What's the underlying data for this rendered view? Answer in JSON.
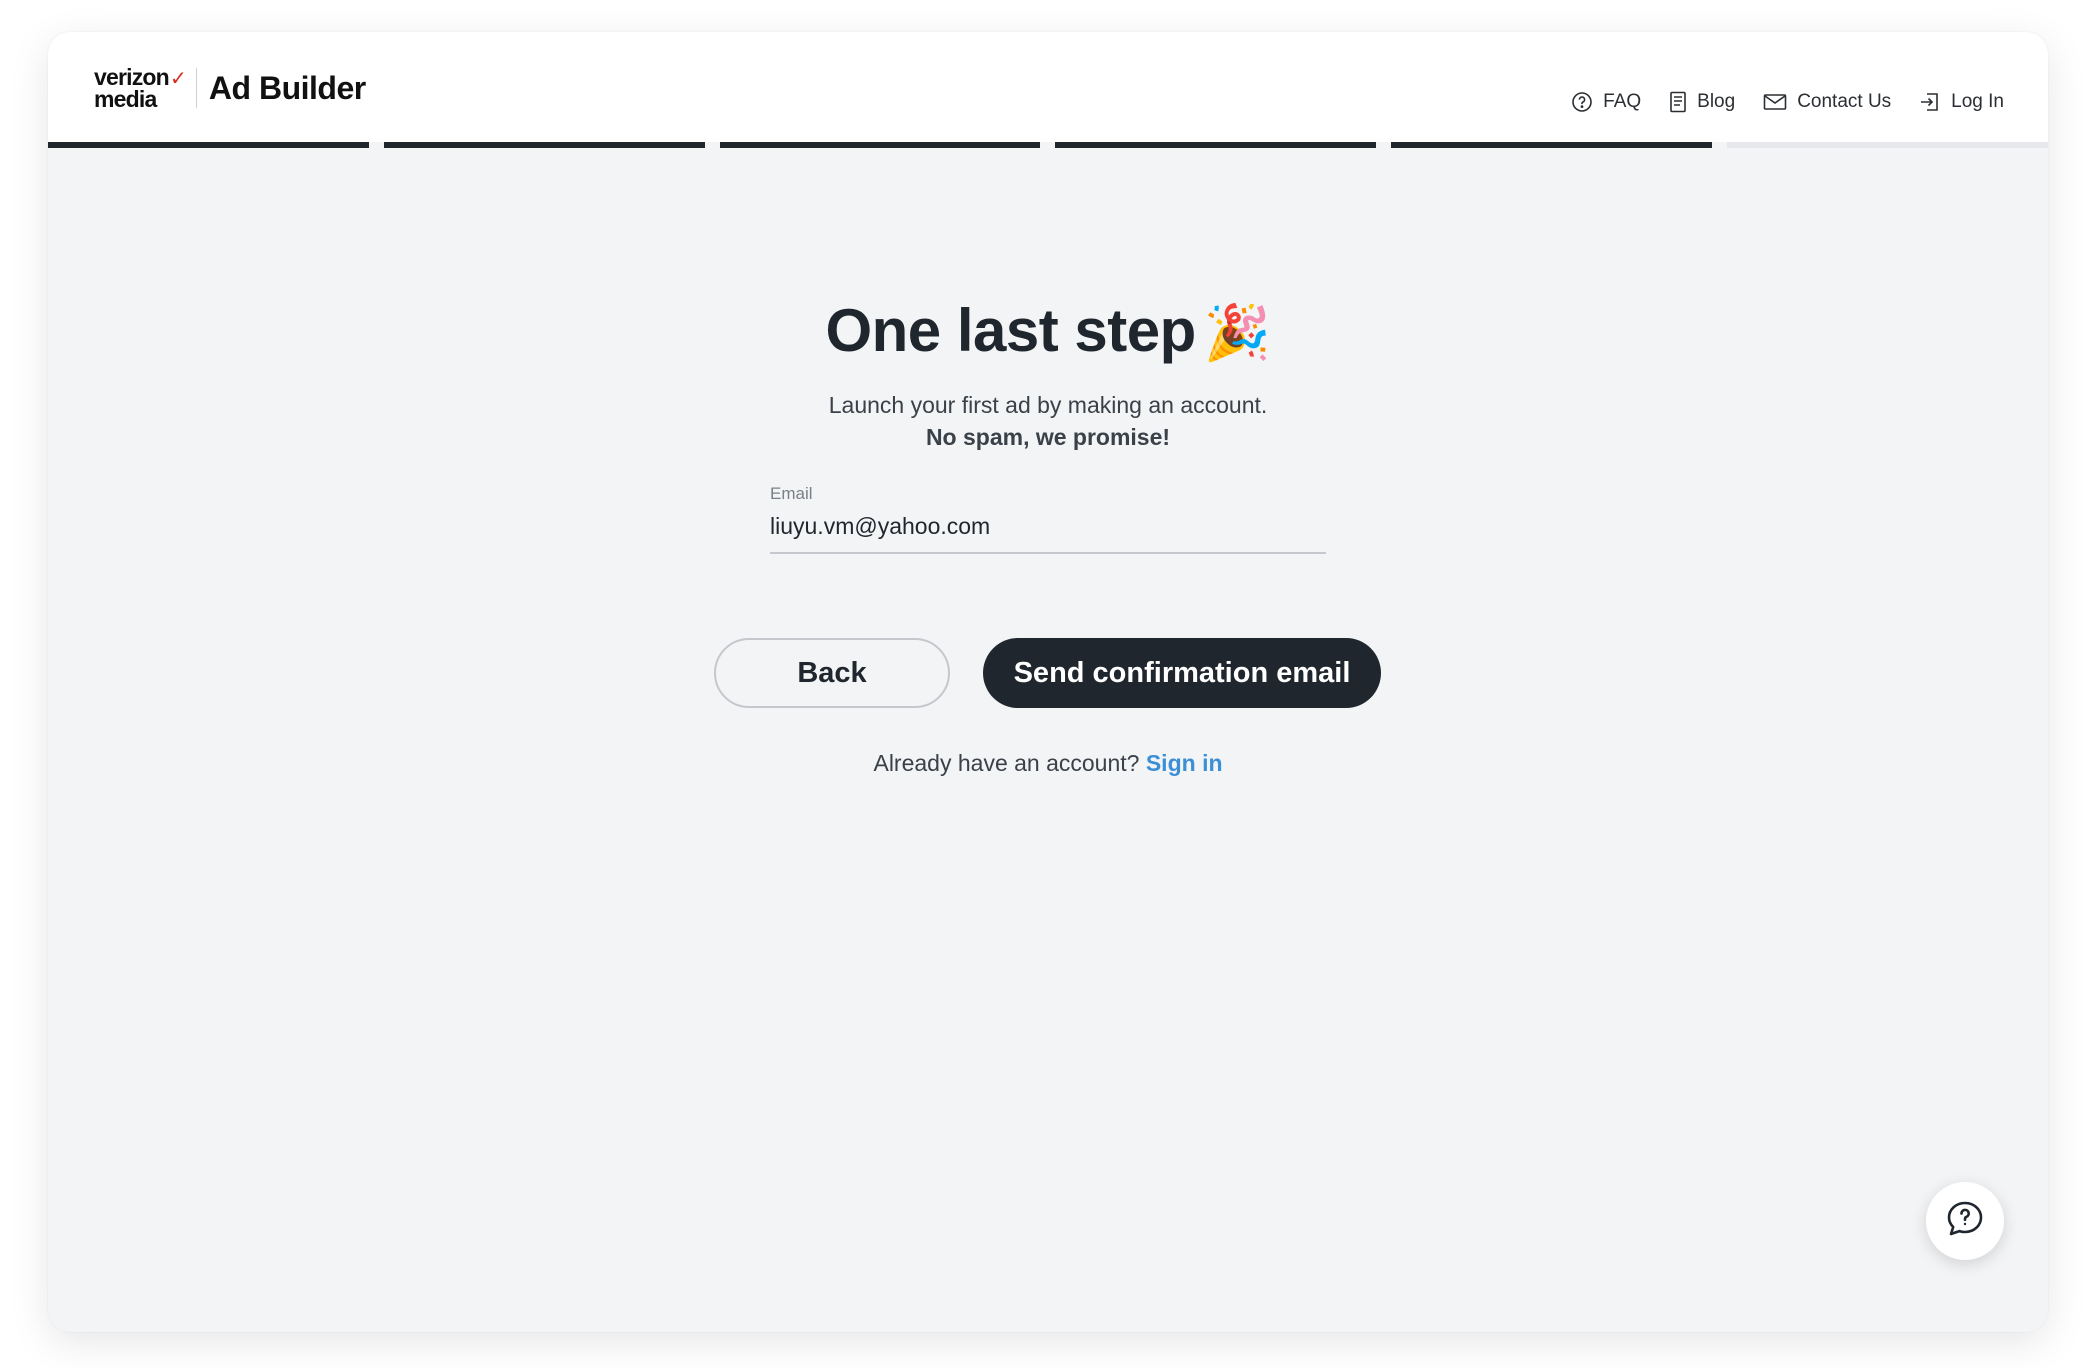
{
  "header": {
    "brand_line1": "verizon",
    "brand_check": "✓",
    "brand_line2": "media",
    "product": "Ad Builder",
    "nav": [
      {
        "label": "FAQ",
        "icon": "question-circle-icon"
      },
      {
        "label": "Blog",
        "icon": "document-icon"
      },
      {
        "label": "Contact Us",
        "icon": "envelope-icon"
      },
      {
        "label": "Log In",
        "icon": "login-icon"
      }
    ]
  },
  "progress": {
    "total_steps": 6,
    "completed_steps": 5,
    "active_color": "#1f262d",
    "inactive_color": "#e6e8eb"
  },
  "main": {
    "title": "One last step",
    "title_emoji": "🎉",
    "subtitle": "Launch your first ad by making an account.",
    "subtitle_bold": "No spam, we promise!",
    "email_label": "Email",
    "email_value": "liuyu.vm@yahoo.com",
    "back_label": "Back",
    "send_label": "Send confirmation email",
    "signin_prompt": "Already have an account?",
    "signin_link": "Sign in"
  },
  "colors": {
    "accent": "#1f262d",
    "link": "#3b8fd6",
    "brand_red": "#d52b1e",
    "background": "#f3f4f6"
  },
  "chat": {
    "icon": "chat-help-icon"
  }
}
